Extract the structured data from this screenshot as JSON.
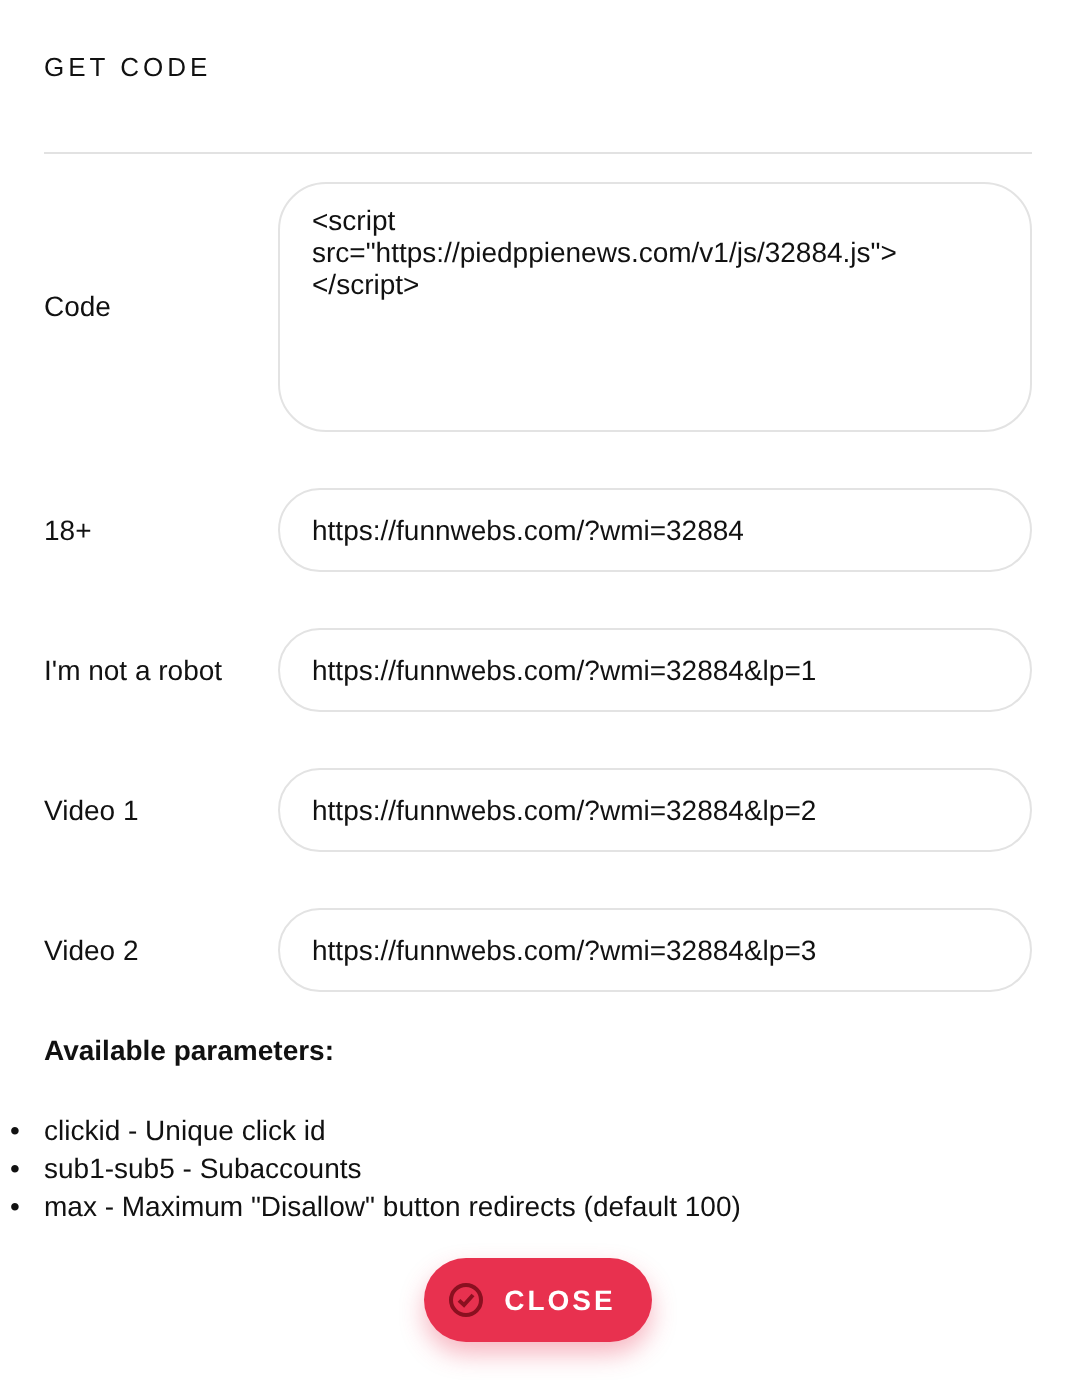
{
  "title": "GET CODE",
  "fields": [
    {
      "kind": "code",
      "label": "Code",
      "lines": [
        "<script",
        "src=\"https://piedppienews.com/v1/js/32884.js\">",
        "</script>"
      ]
    },
    {
      "kind": "link",
      "label": "18+",
      "value": "https://funnwebs.com/?wmi=32884"
    },
    {
      "kind": "link",
      "label": "I'm not a robot",
      "value": "https://funnwebs.com/?wmi=32884&lp=1"
    },
    {
      "kind": "link",
      "label": "Video 1",
      "value": "https://funnwebs.com/?wmi=32884&lp=2"
    },
    {
      "kind": "link",
      "label": "Video 2",
      "value": "https://funnwebs.com/?wmi=32884&lp=3"
    }
  ],
  "params_heading": "Available parameters:",
  "params": [
    {
      "bullet": "•",
      "text": "clickid - Unique click id"
    },
    {
      "bullet": "•",
      "text": "sub1-sub5 - Subaccounts"
    },
    {
      "bullet": "•",
      "text": "max - Maximum \"Disallow\" button redirects (default 100)"
    }
  ],
  "close_button": "CLOSE"
}
